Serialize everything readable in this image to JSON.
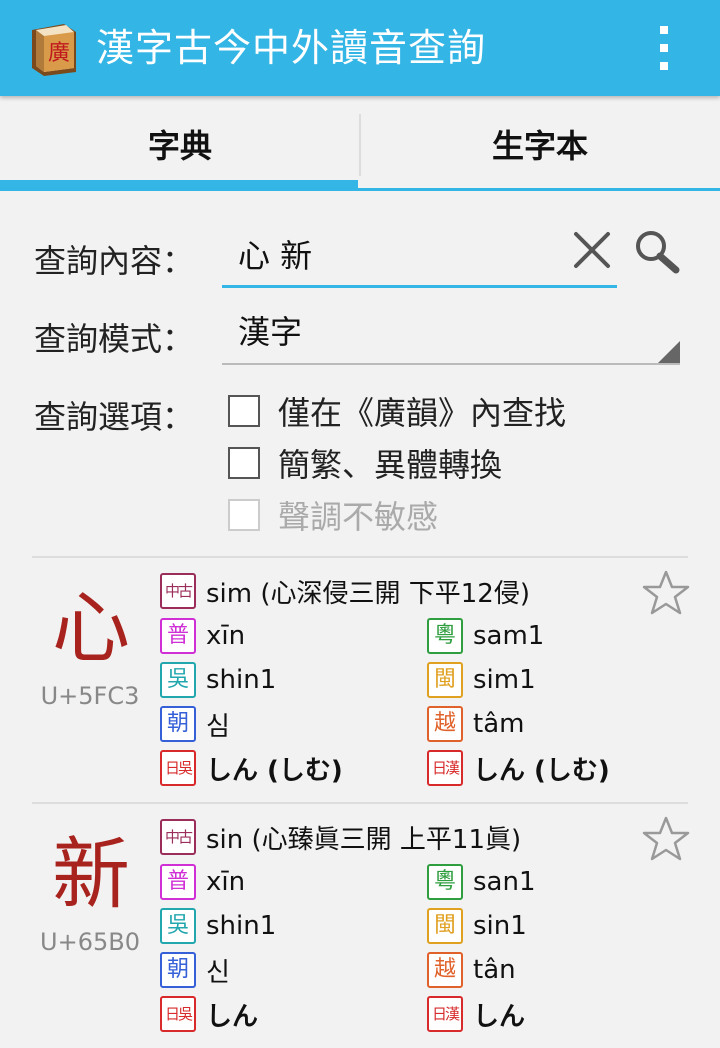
{
  "app": {
    "title": "漢字古今中外讀音查詢"
  },
  "tabs": [
    {
      "label": "字典",
      "selected": true
    },
    {
      "label": "生字本",
      "selected": false
    }
  ],
  "form": {
    "query_label": "查詢內容：",
    "query_value": "心 新",
    "mode_label": "查詢模式：",
    "mode_value": "漢字",
    "options_label": "查詢選項：",
    "options": [
      {
        "label": "僅在《廣韻》內查找",
        "checked": false,
        "enabled": true
      },
      {
        "label": "簡繁、異體轉換",
        "checked": false,
        "enabled": true
      },
      {
        "label": "聲調不敏感",
        "checked": false,
        "enabled": false
      }
    ]
  },
  "colors": {
    "accent": "#33b5e5",
    "character": "#a8231e",
    "middle_chinese": "#9b2d5a",
    "mandarin": "#d02fd6",
    "cantonese": "#2f9e3f",
    "wu": "#23a7ae",
    "minnan": "#e0a020",
    "korean": "#3560d8",
    "vietnamese": "#e0622a",
    "japanese": "#d82a2a"
  },
  "badges": {
    "middle_chinese": "中古",
    "mandarin": "普",
    "cantonese": "粵",
    "wu": "吳",
    "minnan": "閩",
    "korean": "朝",
    "vietnamese": "越",
    "japanese_go": "日吳",
    "japanese_kan": "日漢"
  },
  "icons": [
    "app-book-icon",
    "overflow-menu-icon",
    "clear-icon",
    "search-icon",
    "star-outline-icon"
  ],
  "entries": [
    {
      "character": "心",
      "codepoint": "U+5FC3",
      "favorite": false,
      "middle_chinese": "sim (心深侵三開 下平12侵)",
      "mandarin": "xīn",
      "cantonese": "sam1",
      "wu": "shin1",
      "minnan": "sim1",
      "korean": "심",
      "vietnamese": "tâm",
      "japanese_go": "しん (しむ)",
      "japanese_kan": "しん (しむ)"
    },
    {
      "character": "新",
      "codepoint": "U+65B0",
      "favorite": false,
      "middle_chinese": "sin (心臻眞三開 上平11眞)",
      "mandarin": "xīn",
      "cantonese": "san1",
      "wu": "shin1",
      "minnan": "sin1",
      "korean": "신",
      "vietnamese": "tân",
      "japanese_go": "しん",
      "japanese_kan": "しん"
    }
  ]
}
